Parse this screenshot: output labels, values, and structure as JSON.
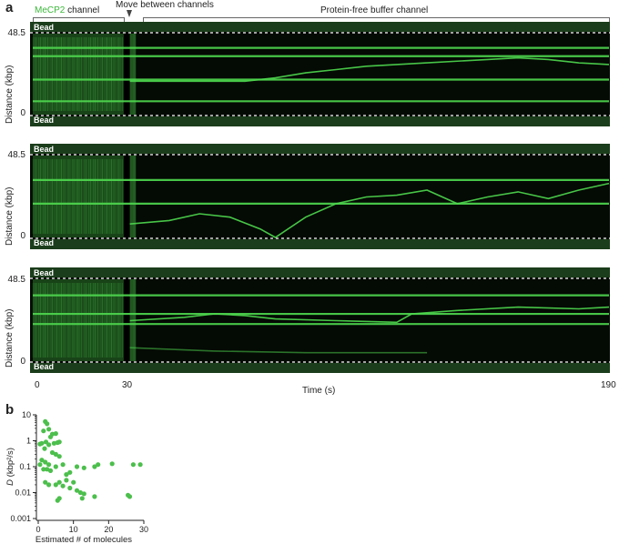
{
  "panel_a": {
    "letter": "a",
    "header": {
      "mecp2_prefix": "MeCP2",
      "mecp2_suffix": " channel",
      "move": "Move between channels",
      "buffer": "Protein-free buffer channel"
    },
    "bead_label": "Bead",
    "y_label": "Distance (kbp)",
    "y_ticks": [
      "48.5",
      "0"
    ],
    "x_ticks": [
      "0",
      "30",
      "190"
    ],
    "x_label": "Time (s)",
    "colors": {
      "signal": "#4fd94f",
      "background": "#040a04"
    }
  },
  "panel_b": {
    "letter": "b"
  },
  "chart_data": [
    {
      "type": "heatmap",
      "description_source": "kymograph 1",
      "xlabel": "Time (s)",
      "ylabel": "Distance (kbp)",
      "xlim": [
        0,
        190
      ],
      "ylim": [
        0,
        48.5
      ],
      "traces": [
        {
          "kind": "static",
          "y": 40
        },
        {
          "kind": "static",
          "y": 35
        },
        {
          "kind": "static",
          "y": 21
        },
        {
          "kind": "static",
          "y": 8
        },
        {
          "kind": "diffusing",
          "points": [
            [
              32,
              20
            ],
            [
              50,
              20
            ],
            [
              70,
              20
            ],
            [
              80,
              22
            ],
            [
              90,
              25
            ],
            [
              100,
              27
            ],
            [
              110,
              29
            ],
            [
              130,
              31
            ],
            [
              150,
              33
            ],
            [
              160,
              34
            ],
            [
              170,
              33
            ],
            [
              180,
              31
            ],
            [
              190,
              30
            ]
          ]
        }
      ]
    },
    {
      "type": "heatmap",
      "description_source": "kymograph 2",
      "xlabel": "Time (s)",
      "ylabel": "Distance (kbp)",
      "xlim": [
        0,
        190
      ],
      "ylim": [
        0,
        48.5
      ],
      "traces": [
        {
          "kind": "static",
          "y": 34
        },
        {
          "kind": "static",
          "y": 20
        },
        {
          "kind": "diffusing",
          "points": [
            [
              32,
              8
            ],
            [
              45,
              10
            ],
            [
              55,
              14
            ],
            [
              65,
              12
            ],
            [
              75,
              5
            ],
            [
              80,
              0
            ],
            [
              90,
              12
            ],
            [
              100,
              20
            ],
            [
              110,
              24
            ],
            [
              120,
              25
            ],
            [
              130,
              28
            ],
            [
              140,
              20
            ],
            [
              150,
              24
            ],
            [
              160,
              27
            ],
            [
              170,
              23
            ],
            [
              180,
              28
            ],
            [
              190,
              32
            ]
          ]
        }
      ]
    },
    {
      "type": "heatmap",
      "description_source": "kymograph 3",
      "xlabel": "Time (s)",
      "ylabel": "Distance (kbp)",
      "xlim": [
        0,
        190
      ],
      "ylim": [
        0,
        48.5
      ],
      "traces": [
        {
          "kind": "static",
          "y": 39
        },
        {
          "kind": "static",
          "y": 28
        },
        {
          "kind": "static",
          "y": 22
        },
        {
          "kind": "diffusing",
          "points": [
            [
              32,
              24
            ],
            [
              50,
              26
            ],
            [
              60,
              28
            ],
            [
              70,
              27
            ],
            [
              80,
              25
            ],
            [
              100,
              24
            ],
            [
              120,
              23
            ],
            [
              125,
              28
            ],
            [
              140,
              30
            ],
            [
              160,
              32
            ],
            [
              180,
              31
            ],
            [
              190,
              32
            ]
          ]
        },
        {
          "kind": "fading",
          "points": [
            [
              32,
              8
            ],
            [
              60,
              6
            ],
            [
              90,
              5
            ],
            [
              130,
              5
            ]
          ]
        }
      ]
    },
    {
      "type": "scatter",
      "xlabel": "Estimated # of molecules",
      "ylabel": "D (kbp²/s)",
      "ylabel_main": "D",
      "ylabel_unit": " (kbp²/s)",
      "y_scale": "log",
      "xlim": [
        0,
        30
      ],
      "ylim": [
        0.001,
        10
      ],
      "x_ticks": [
        "0",
        "10",
        "20",
        "30"
      ],
      "y_ticks": [
        "10",
        "1",
        "0.1",
        "0.01",
        "0.001"
      ],
      "y_tick_values": [
        10,
        1,
        0.1,
        0.01,
        0.001
      ],
      "x_tick_values": [
        0,
        10,
        20,
        30
      ],
      "color": "#4cbf4c",
      "points": [
        [
          2,
          5.5
        ],
        [
          2.5,
          4.5
        ],
        [
          3,
          2.8
        ],
        [
          1.5,
          2.4
        ],
        [
          4,
          1.8
        ],
        [
          5,
          1.9
        ],
        [
          3.5,
          1.4
        ],
        [
          2.2,
          0.9
        ],
        [
          1,
          0.8
        ],
        [
          0.5,
          0.75
        ],
        [
          3,
          0.7
        ],
        [
          4.5,
          0.8
        ],
        [
          5.5,
          0.85
        ],
        [
          6,
          0.9
        ],
        [
          1.8,
          0.5
        ],
        [
          4,
          0.35
        ],
        [
          5,
          0.3
        ],
        [
          1,
          0.18
        ],
        [
          2,
          0.15
        ],
        [
          0.5,
          0.12
        ],
        [
          3,
          0.12
        ],
        [
          5,
          0.1
        ],
        [
          1.5,
          0.08
        ],
        [
          2.5,
          0.08
        ],
        [
          3.5,
          0.07
        ],
        [
          6,
          0.25
        ],
        [
          7,
          0.12
        ],
        [
          8,
          0.05
        ],
        [
          9,
          0.06
        ],
        [
          11,
          0.1
        ],
        [
          13,
          0.09
        ],
        [
          16,
          0.1
        ],
        [
          17,
          0.12
        ],
        [
          21,
          0.13
        ],
        [
          27,
          0.12
        ],
        [
          29,
          0.12
        ],
        [
          8,
          0.03
        ],
        [
          10,
          0.025
        ],
        [
          6,
          0.025
        ],
        [
          5,
          0.02
        ],
        [
          7,
          0.018
        ],
        [
          9,
          0.015
        ],
        [
          11,
          0.012
        ],
        [
          12,
          0.01
        ],
        [
          13,
          0.009
        ],
        [
          3,
          0.02
        ],
        [
          2,
          0.025
        ],
        [
          6,
          0.006
        ],
        [
          5.5,
          0.005
        ],
        [
          12.5,
          0.006
        ],
        [
          16,
          0.007
        ],
        [
          25.5,
          0.008
        ],
        [
          26,
          0.007
        ]
      ]
    }
  ]
}
